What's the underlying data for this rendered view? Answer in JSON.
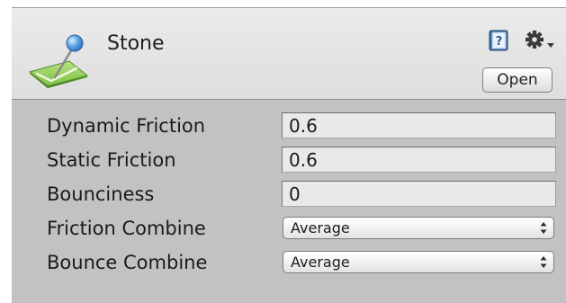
{
  "asset": {
    "name": "Stone",
    "icon": "physic-material-icon"
  },
  "header": {
    "help_icon": "help-book-icon",
    "gear_icon": "gear-dropdown-icon",
    "open_label": "Open"
  },
  "properties": [
    {
      "label": "Dynamic Friction",
      "value": "0.6",
      "kind": "number"
    },
    {
      "label": "Static Friction",
      "value": "0.6",
      "kind": "number"
    },
    {
      "label": "Bounciness",
      "value": "0",
      "kind": "number"
    },
    {
      "label": "Friction Combine",
      "value": "Average",
      "kind": "select"
    },
    {
      "label": "Bounce Combine",
      "value": "Average",
      "kind": "select"
    }
  ],
  "colors": {
    "panel_bg": "#c2c2c2",
    "header_bg": "#e4e4e4",
    "field_bg": "#e9e9e9",
    "icon_green": "#7ec04a",
    "icon_blue": "#3f8fd8"
  }
}
